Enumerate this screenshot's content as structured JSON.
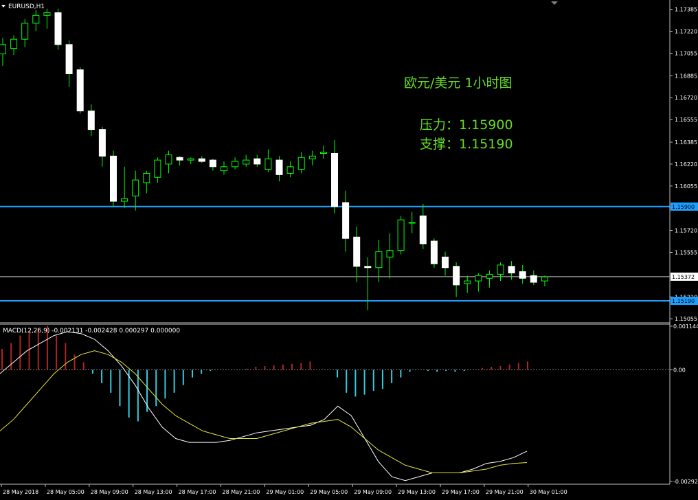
{
  "symbol_label": "EURUSD,H1",
  "annotation": {
    "title": "欧元/美元  1小时图",
    "resistance": "压力：1.15900",
    "support": "支撑：1.15190",
    "color": "#66dd22"
  },
  "colors": {
    "background": "#000000",
    "candle_up_fill": "#000000",
    "candle_down_fill": "#ffffff",
    "candle_outline": "#ffffff",
    "wick": "#00ff00",
    "level_line": "#1e9fff",
    "current_line": "#c0c0c0",
    "macd_pos": "#b22222",
    "macd_neg": "#33ccdd",
    "macd_line": "#ffffff",
    "signal_line": "#e6e640"
  },
  "indicator_label": "MACD(12,26,9) -0.002131 -0.002428 0.000297 0.000000",
  "chart_data": [
    {
      "type": "candlestick",
      "title": "EURUSD,H1",
      "y_range": [
        1.1503,
        1.1744
      ],
      "y_ticks": [
        "1.17385",
        "1.17220",
        "1.17055",
        "1.16885",
        "1.16720",
        "1.16555",
        "1.16385",
        "1.16220",
        "1.16055",
        "1.15890",
        "1.15720",
        "1.15555",
        "1.15385",
        "1.15220",
        "1.15055"
      ],
      "y_tick_values": [
        1.17385,
        1.1722,
        1.17055,
        1.16885,
        1.1672,
        1.16555,
        1.16385,
        1.1622,
        1.16055,
        1.1589,
        1.1572,
        1.15555,
        1.15385,
        1.1522,
        1.15055
      ],
      "levels": [
        {
          "label": "1.15900",
          "value": 1.159,
          "kind": "resistance"
        },
        {
          "label": "1.15190",
          "value": 1.1519,
          "kind": "support"
        }
      ],
      "current_price": {
        "label": "1.15372",
        "value": 1.15372
      },
      "x_labels": [
        "28 May 2018",
        "28 May 05:00",
        "28 May 09:00",
        "28 May 13:00",
        "28 May 17:00",
        "28 May 21:00",
        "29 May 01:00",
        "29 May 05:00",
        "29 May 09:00",
        "29 May 13:00",
        "29 May 17:00",
        "29 May 21:00",
        "30 May 01:00"
      ],
      "candles": [
        [
          1.1705,
          1.1717,
          1.1696,
          1.1712
        ],
        [
          1.1709,
          1.1719,
          1.1704,
          1.1716
        ],
        [
          1.1716,
          1.1731,
          1.171,
          1.1728
        ],
        [
          1.1728,
          1.1738,
          1.1722,
          1.1734
        ],
        [
          1.1734,
          1.1739,
          1.1724,
          1.1736
        ],
        [
          1.1736,
          1.1739,
          1.1708,
          1.1712
        ],
        [
          1.1712,
          1.1715,
          1.168,
          1.169
        ],
        [
          1.1693,
          1.1695,
          1.166,
          1.1662
        ],
        [
          1.1662,
          1.1667,
          1.1643,
          1.1648
        ],
        [
          1.1648,
          1.165,
          1.162,
          1.1628
        ],
        [
          1.1628,
          1.1632,
          1.159,
          1.1594
        ],
        [
          1.1594,
          1.162,
          1.1589,
          1.1596
        ],
        [
          1.1598,
          1.1617,
          1.1587,
          1.161
        ],
        [
          1.1608,
          1.1617,
          1.16,
          1.1615
        ],
        [
          1.1612,
          1.1627,
          1.1608,
          1.1625
        ],
        [
          1.1622,
          1.1632,
          1.1615,
          1.1629
        ],
        [
          1.1627,
          1.1628,
          1.1621,
          1.1625
        ],
        [
          1.1625,
          1.1627,
          1.1622,
          1.1626
        ],
        [
          1.1626,
          1.1628,
          1.1623,
          1.1624
        ],
        [
          1.1625,
          1.1626,
          1.1617,
          1.162
        ],
        [
          1.1617,
          1.1624,
          1.1614,
          1.162
        ],
        [
          1.162,
          1.1627,
          1.1618,
          1.1624
        ],
        [
          1.1622,
          1.1629,
          1.162,
          1.1625
        ],
        [
          1.1626,
          1.1629,
          1.162,
          1.1622
        ],
        [
          1.1618,
          1.1633,
          1.1616,
          1.1626
        ],
        [
          1.1625,
          1.1628,
          1.1609,
          1.1614
        ],
        [
          1.1615,
          1.1624,
          1.1612,
          1.162
        ],
        [
          1.1618,
          1.1631,
          1.1615,
          1.1627
        ],
        [
          1.1626,
          1.1632,
          1.1621,
          1.1628
        ],
        [
          1.163,
          1.1636,
          1.1626,
          1.1631
        ],
        [
          1.163,
          1.164,
          1.1585,
          1.159
        ],
        [
          1.1593,
          1.1602,
          1.1556,
          1.1566
        ],
        [
          1.1567,
          1.1575,
          1.1533,
          1.1545
        ],
        [
          1.1545,
          1.1552,
          1.1512,
          1.1544
        ],
        [
          1.1544,
          1.1565,
          1.1533,
          1.1556
        ],
        [
          1.1552,
          1.157,
          1.1536,
          1.1557
        ],
        [
          1.1557,
          1.1583,
          1.1554,
          1.158
        ],
        [
          1.1578,
          1.1586,
          1.157,
          1.1578
        ],
        [
          1.1583,
          1.1592,
          1.1558,
          1.1562
        ],
        [
          1.1564,
          1.1566,
          1.1544,
          1.1547
        ],
        [
          1.1552,
          1.1556,
          1.1538,
          1.1544
        ],
        [
          1.1545,
          1.1548,
          1.1522,
          1.1531
        ],
        [
          1.1532,
          1.1538,
          1.1525,
          1.1534
        ],
        [
          1.1534,
          1.154,
          1.1526,
          1.1538
        ],
        [
          1.1536,
          1.1542,
          1.1529,
          1.1539
        ],
        [
          1.1539,
          1.1548,
          1.1534,
          1.1546
        ],
        [
          1.1545,
          1.1549,
          1.1535,
          1.154
        ],
        [
          1.1541,
          1.1546,
          1.1532,
          1.1536
        ],
        [
          1.1538,
          1.1542,
          1.1531,
          1.1533
        ],
        [
          1.1534,
          1.1538,
          1.153,
          1.1537
        ]
      ]
    },
    {
      "type": "line",
      "title": "MACD(12,26,9)",
      "y_range": [
        -0.00296,
        0.00116
      ],
      "y_ticks": [
        "0.001144",
        "0.00",
        "-0.002923"
      ],
      "y_tick_values": [
        0.001144,
        0.0,
        -0.002923
      ],
      "histogram": [
        0.00055,
        0.0007,
        0.0009,
        0.001,
        0.0011,
        0.00115,
        0.0009,
        0.0007,
        0.0004,
        0.0002,
        -0.0001,
        -0.00035,
        -0.0006,
        -0.00095,
        -0.00125,
        -0.00135,
        -0.0011,
        -0.00095,
        -0.00075,
        -0.0006,
        -0.0004,
        -0.0002,
        -0.0001,
        -3e-05,
        0.0,
        0.0,
        0.0,
        3e-05,
        8e-05,
        0.0001,
        0.00012,
        0.00014,
        0.00016,
        0.00018,
        0.00022,
        0.0,
        0.0,
        -0.0002,
        -0.0006,
        -0.0007,
        -0.00065,
        -0.00055,
        -0.0005,
        -0.00035,
        -0.0002,
        -5e-05,
        0.0,
        -3e-05,
        -5e-05,
        -3e-05,
        -5e-05,
        -3e-05,
        0.0,
        5e-05,
        8e-05,
        0.0001,
        0.00014,
        0.00018,
        0.00022
      ],
      "series": [
        {
          "name": "MACD",
          "values": [
            -0.0001,
            0.0002,
            0.0005,
            0.0007,
            0.0009,
            0.001,
            0.00095,
            0.0008,
            0.0005,
            0.0001,
            -0.0004,
            -0.001,
            -0.0015,
            -0.0018,
            -0.0019,
            -0.0019,
            -0.0019,
            -0.00185,
            -0.00175,
            -0.00165,
            -0.0016,
            -0.00155,
            -0.0015,
            -0.00145,
            -0.0013,
            -0.00095,
            -0.0012,
            -0.0018,
            -0.0024,
            -0.0028,
            -0.0029,
            -0.0028,
            -0.0027,
            -0.0027,
            -0.0027,
            -0.0026,
            -0.00245,
            -0.0024,
            -0.0023,
            -0.00213
          ]
        },
        {
          "name": "Signal",
          "values": [
            -0.0016,
            -0.0013,
            -0.0009,
            -0.0005,
            -0.0001,
            0.0002,
            0.0004,
            0.0005,
            0.0004,
            0.0002,
            -0.0001,
            -0.0005,
            -0.0009,
            -0.0012,
            -0.0014,
            -0.0016,
            -0.0017,
            -0.0018,
            -0.0018,
            -0.0018,
            -0.0017,
            -0.0016,
            -0.0015,
            -0.0014,
            -0.00135,
            -0.0013,
            -0.0015,
            -0.0018,
            -0.0021,
            -0.0023,
            -0.0025,
            -0.0026,
            -0.0027,
            -0.0027,
            -0.0027,
            -0.00265,
            -0.0026,
            -0.0025,
            -0.00245,
            -0.00243
          ]
        }
      ]
    }
  ]
}
